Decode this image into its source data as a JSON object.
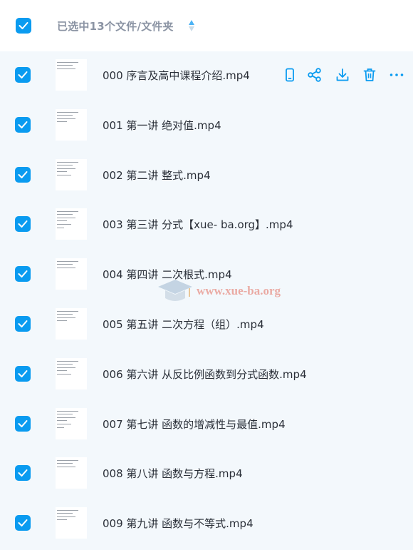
{
  "header": {
    "title": "已选中13个文件/文件夹"
  },
  "files": [
    {
      "name": "000 序言及高中课程介绍.mp4"
    },
    {
      "name": "001 第一讲 绝对值.mp4"
    },
    {
      "name": "002 第二讲 整式.mp4"
    },
    {
      "name": "003 第三讲 分式【xue- ba.org】.mp4"
    },
    {
      "name": "004 第四讲 二次根式.mp4"
    },
    {
      "name": "005 第五讲 二次方程（组）.mp4"
    },
    {
      "name": "006 第六讲 从反比例函数到分式函数.mp4"
    },
    {
      "name": "007 第七讲 函数的增减性与最值.mp4"
    },
    {
      "name": "008 第八讲 函数与方程.mp4"
    },
    {
      "name": "009 第九讲 函数与不等式.mp4"
    }
  ],
  "row_actions": [
    "phone-icon",
    "share-icon",
    "download-icon",
    "delete-icon",
    "more-icon"
  ],
  "watermark": {
    "text": "www.xue-ba.org"
  },
  "colors": {
    "accent": "#0a9bf0",
    "background": "#f3f8fc",
    "text": "#2a2f38",
    "muted": "#8a93a3"
  }
}
